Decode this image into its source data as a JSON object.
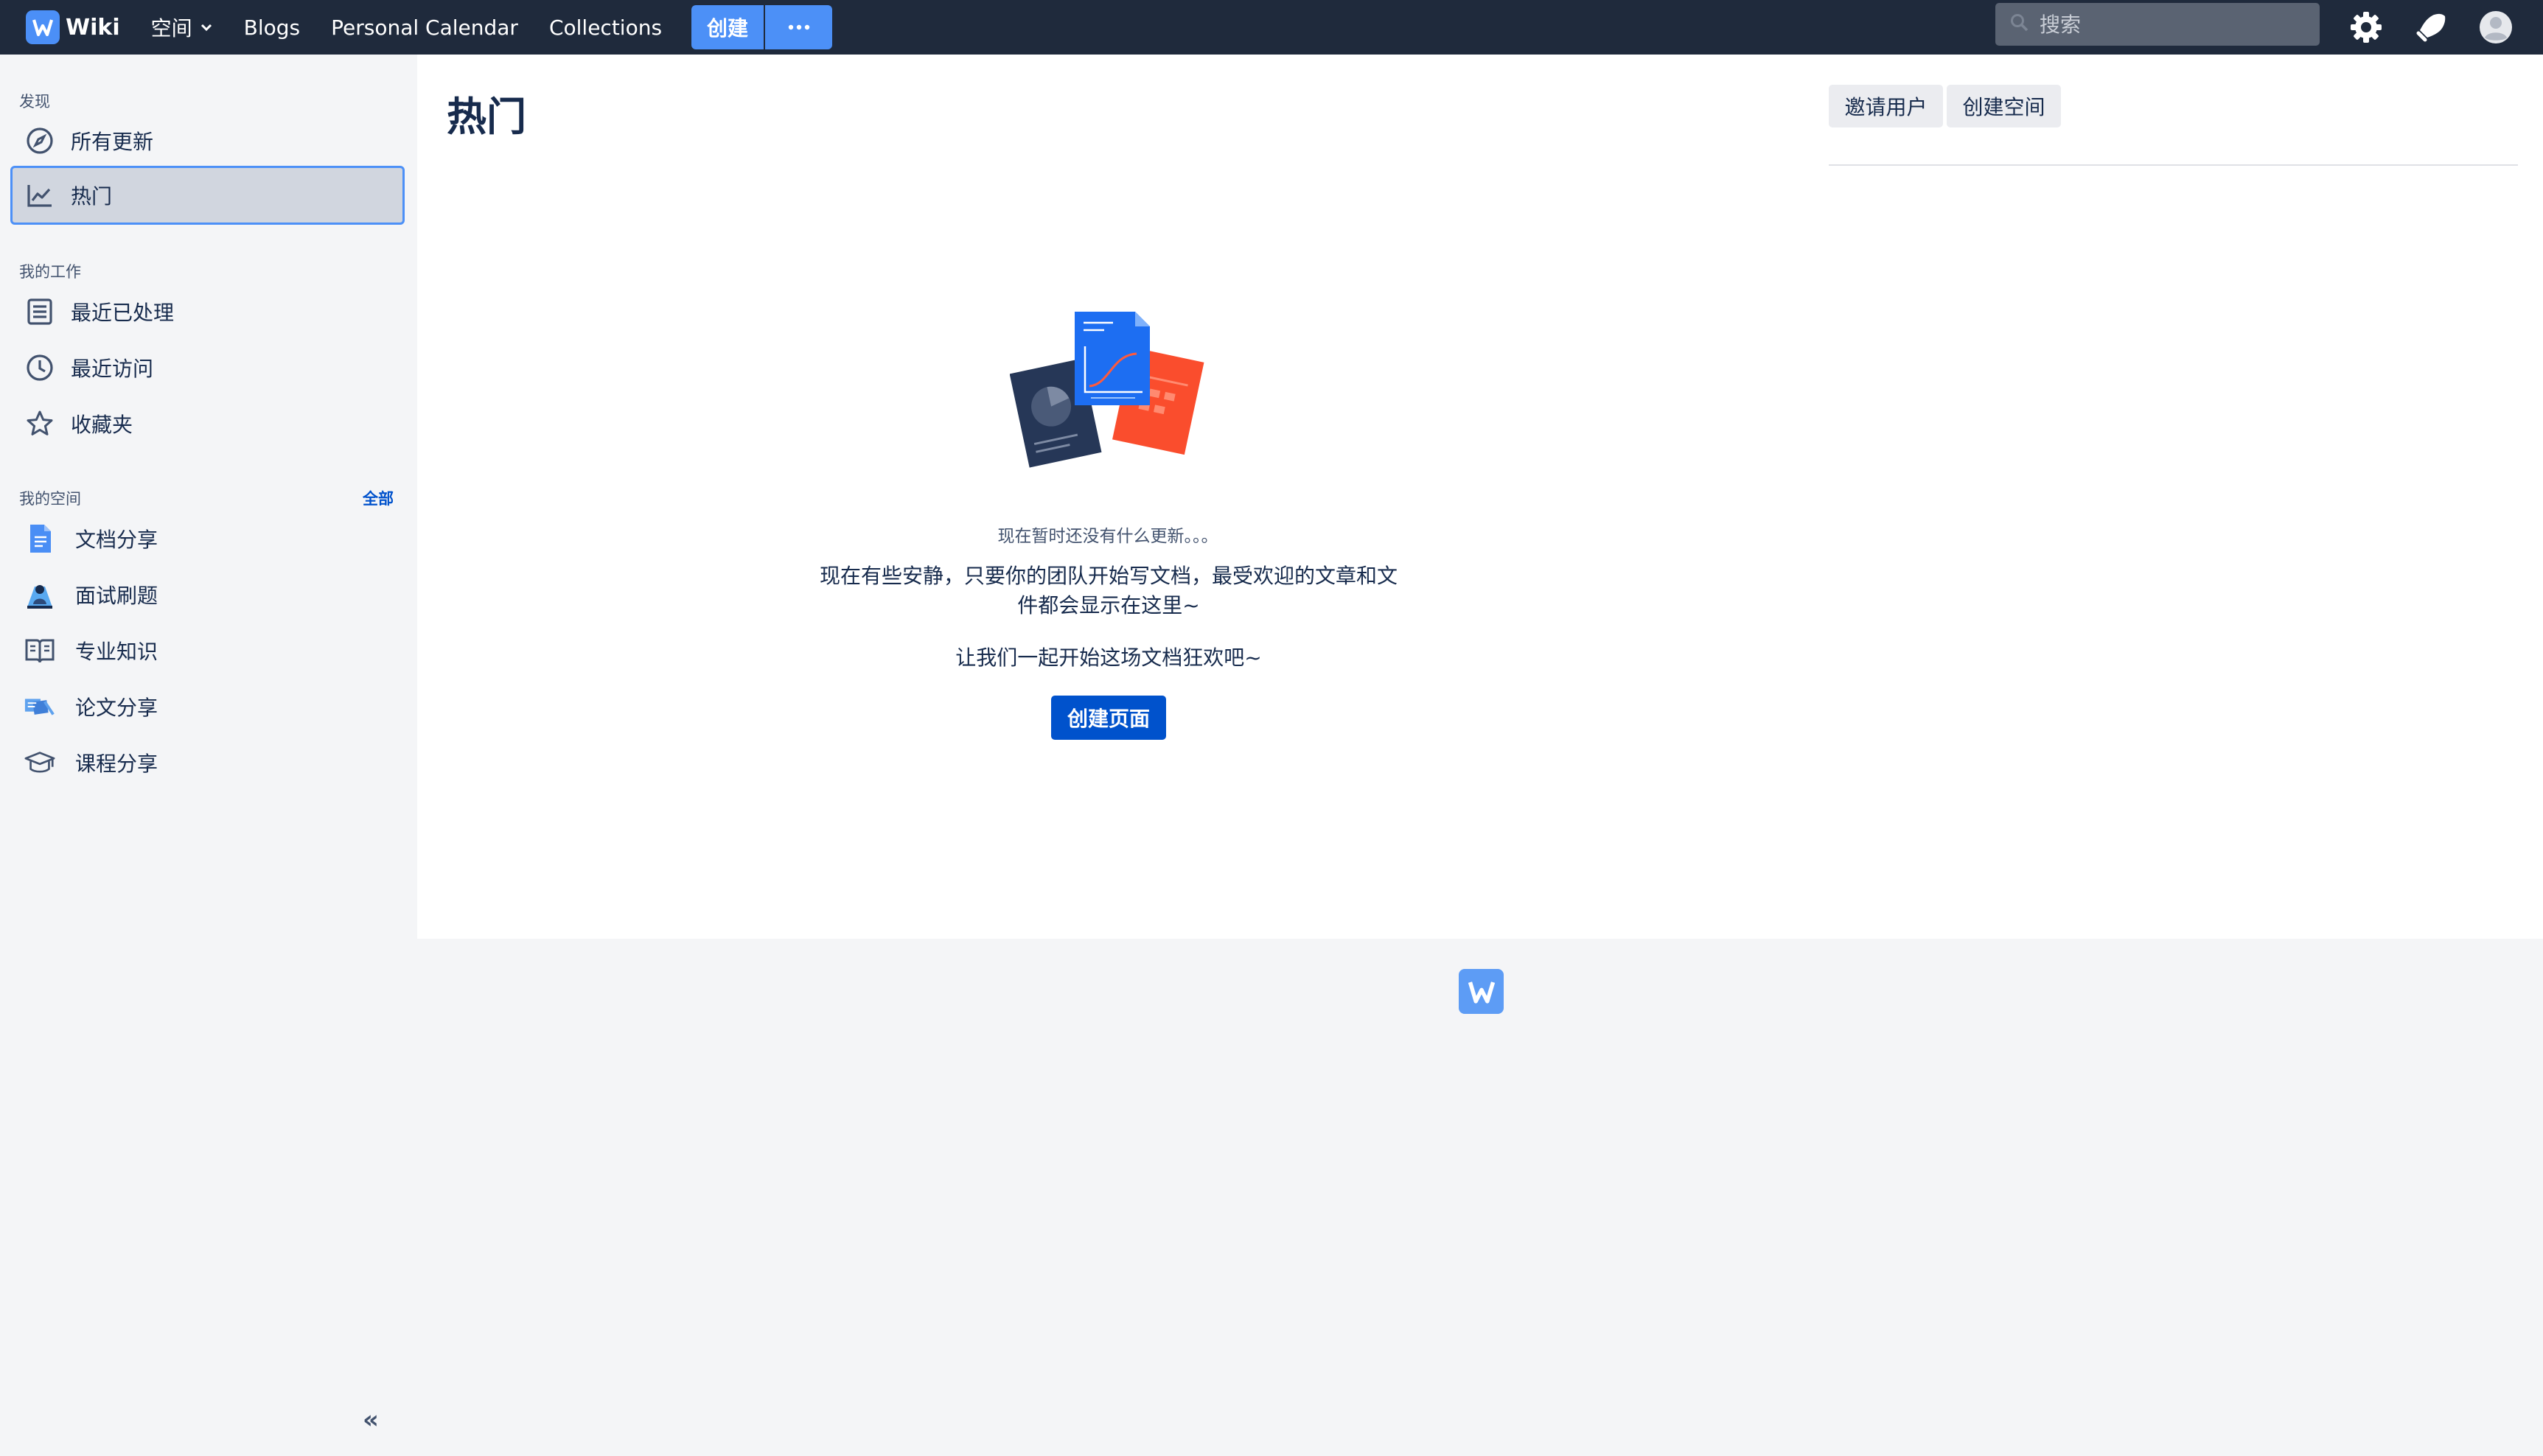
{
  "app": {
    "name": "Wiki",
    "logo_letter": "W"
  },
  "topbar": {
    "spaces_label": "空间",
    "blogs_label": "Blogs",
    "calendar_label": "Personal Calendar",
    "collections_label": "Collections",
    "create_label": "创建",
    "more_label": "···",
    "search_placeholder": "搜索"
  },
  "sidebar": {
    "discover_heading": "发现",
    "discover_items": [
      {
        "label": "所有更新",
        "icon": "compass-icon"
      },
      {
        "label": "热门",
        "icon": "trending-chart-icon",
        "active": true
      }
    ],
    "work_heading": "我的工作",
    "work_items": [
      {
        "label": "最近已处理",
        "icon": "list-document-icon"
      },
      {
        "label": "最近访问",
        "icon": "clock-icon"
      },
      {
        "label": "收藏夹",
        "icon": "star-icon"
      }
    ],
    "spaces_heading": "我的空间",
    "spaces_all": "全部",
    "spaces": [
      {
        "label": "文档分享",
        "icon": "document-icon"
      },
      {
        "label": "面试刷题",
        "icon": "person-board-icon"
      },
      {
        "label": "专业知识",
        "icon": "open-book-icon"
      },
      {
        "label": "论文分享",
        "icon": "papers-icon"
      },
      {
        "label": "课程分享",
        "icon": "graduation-cap-icon"
      }
    ],
    "collapse_label": "«"
  },
  "main": {
    "title": "热门",
    "invite_label": "邀请用户",
    "create_space_label": "创建空间",
    "empty_subtitle": "现在暂时还没有什么更新。。。",
    "empty_line1": "现在有些安静，只要你的团队开始写文档，最受欢迎的文章和文",
    "empty_line2": "件都会显示在这里~",
    "empty_line3": "让我们一起开始这场文档狂欢吧~",
    "create_page_label": "创建页面"
  },
  "colors": {
    "topbar": "#1f2a3c",
    "accent": "#4c90f7",
    "primary": "#0052cc",
    "sidebar_active": "#d1d6df",
    "illustration_blue": "#1d6ef2",
    "illustration_red": "#fa4d2d",
    "illustration_navy": "#263757"
  }
}
